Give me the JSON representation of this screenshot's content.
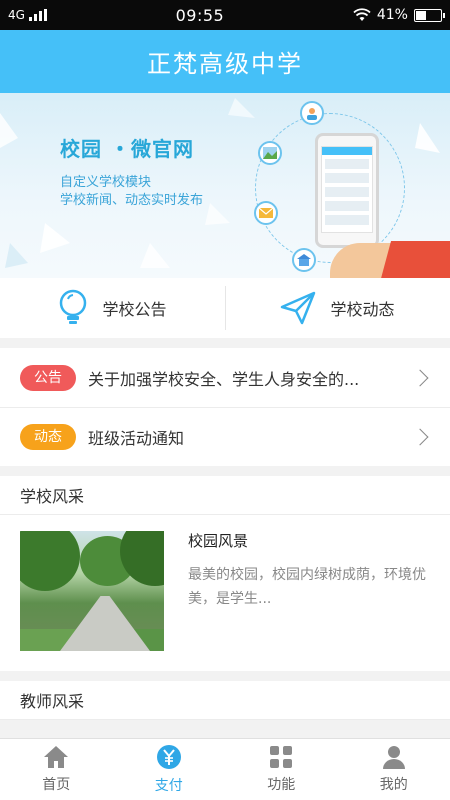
{
  "status_bar": {
    "network": "4G",
    "time": "09:55",
    "battery_percent": "41%",
    "battery_level": 0.41
  },
  "header": {
    "title": "正梵高级中学"
  },
  "banner": {
    "title": "校园 ・微官网",
    "line1": "自定义学校模块",
    "line2": "学校新闻、动态实时发布"
  },
  "quick_nav": [
    {
      "label": "学校公告",
      "icon": "lightbulb-icon"
    },
    {
      "label": "学校动态",
      "icon": "paper-plane-icon"
    }
  ],
  "notices": [
    {
      "tag": "公告",
      "tag_color": "#f05a5a",
      "text": "关于加强学校安全、学生人身安全的..."
    },
    {
      "tag": "动态",
      "tag_color": "#f7a21b",
      "text": "班级活动通知"
    }
  ],
  "school_style": {
    "heading": "学校风采",
    "article": {
      "title": "校园风景",
      "desc": "最美的校园，校园内绿树成荫，环境优美，是学生..."
    }
  },
  "teacher_style": {
    "heading": "教师风采"
  },
  "tabbar": [
    {
      "label": "首页",
      "icon": "home-icon",
      "active": false
    },
    {
      "label": "支付",
      "icon": "yen-icon",
      "active": true
    },
    {
      "label": "功能",
      "icon": "grid-icon",
      "active": false
    },
    {
      "label": "我的",
      "icon": "user-icon",
      "active": false
    }
  ],
  "colors": {
    "primary": "#45c0f8",
    "active_tab": "#2fa7e6"
  }
}
